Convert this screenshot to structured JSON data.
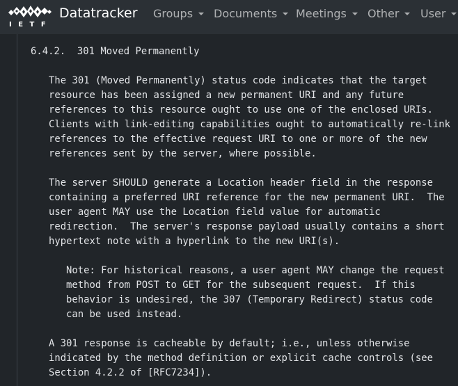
{
  "navbar": {
    "logo_text": "IETF",
    "brand": "Datatracker",
    "menu": [
      {
        "label": "Groups"
      },
      {
        "label": "Documents"
      },
      {
        "label": "Meetings"
      },
      {
        "label": "Other"
      },
      {
        "label": "User"
      }
    ]
  },
  "document": {
    "section_heading": "6.4.2.  301 Moved Permanently",
    "paragraphs": [
      "The 301 (Moved Permanently) status code indicates that the target\nresource has been assigned a new permanent URI and any future\nreferences to this resource ought to use one of the enclosed URIs.\nClients with link-editing capabilities ought to automatically re-link\nreferences to the effective request URI to one or more of the new\nreferences sent by the server, where possible.",
      "The server SHOULD generate a Location header field in the response\ncontaining a preferred URI reference for the new permanent URI.  The\nuser agent MAY use the Location field value for automatic\nredirection.  The server's response payload usually contains a short\nhypertext note with a hyperlink to the new URI(s).",
      "Note: For historical reasons, a user agent MAY change the request\nmethod from POST to GET for the subsequent request.  If this\nbehavior is undesired, the 307 (Temporary Redirect) status code\ncan be used instead.",
      "A 301 response is cacheable by default; i.e., unless otherwise\nindicated by the method definition or explicit cache controls (see\nSection 4.2.2 of [RFC7234])."
    ]
  }
}
